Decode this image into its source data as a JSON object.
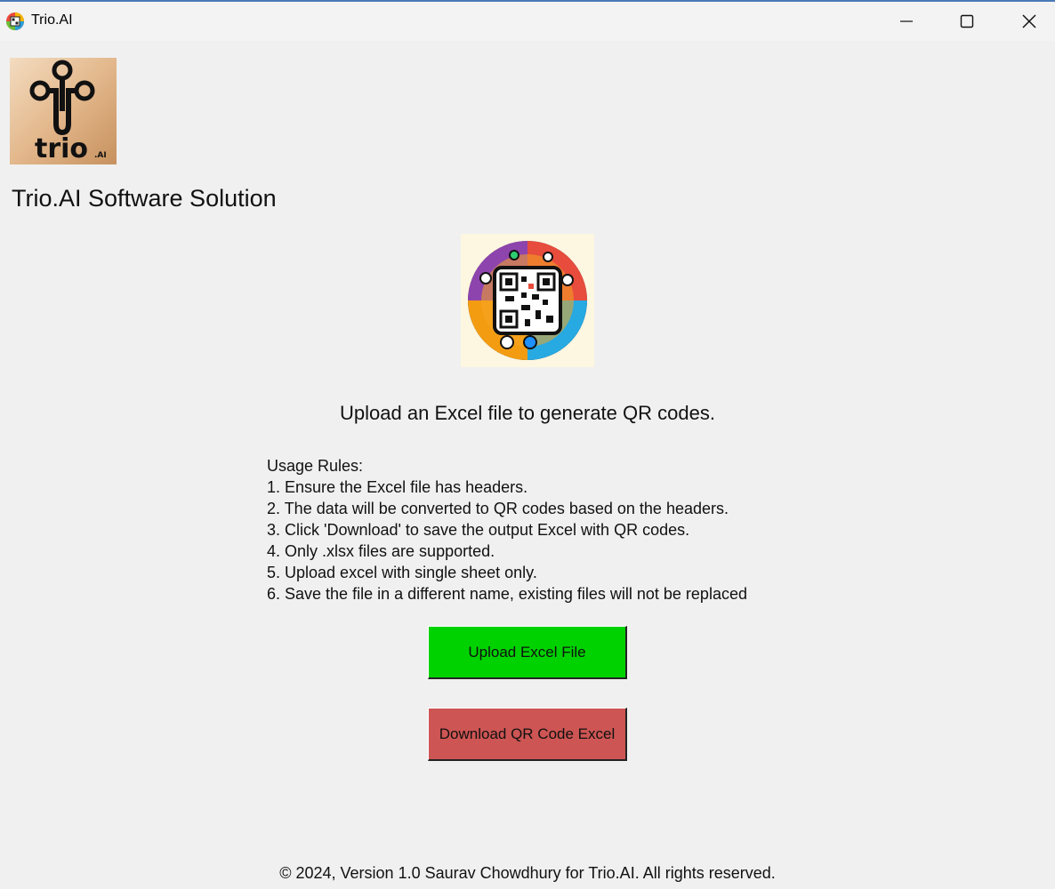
{
  "window": {
    "title": "Trio.AI",
    "controls": [
      "minimize-icon",
      "maximize-icon",
      "close-icon"
    ]
  },
  "branding": {
    "logo_text": "trio",
    "logo_suffix": ".AI",
    "company_name": "Trio.AI Software Solution"
  },
  "main": {
    "subtitle": "Upload an Excel file to generate QR codes.",
    "rules": [
      "Usage Rules:",
      "1. Ensure the Excel file has headers.",
      "2. The data will be converted to QR codes based on the headers.",
      "3. Click 'Download' to save the output Excel with QR codes.",
      "4. Only .xlsx files are supported.",
      "5. Upload excel with single sheet only.",
      "6. Save the file in a different name, existing files will not be replaced"
    ],
    "upload_label": "Upload Excel File",
    "download_label": "Download QR Code Excel"
  },
  "footer": {
    "text": "© 2024, Version 1.0 Saurav Chowdhury for Trio.AI. All rights reserved."
  },
  "colors": {
    "upload_button": "#00d200",
    "download_button": "#cd5553",
    "background": "#f0f0f0"
  }
}
